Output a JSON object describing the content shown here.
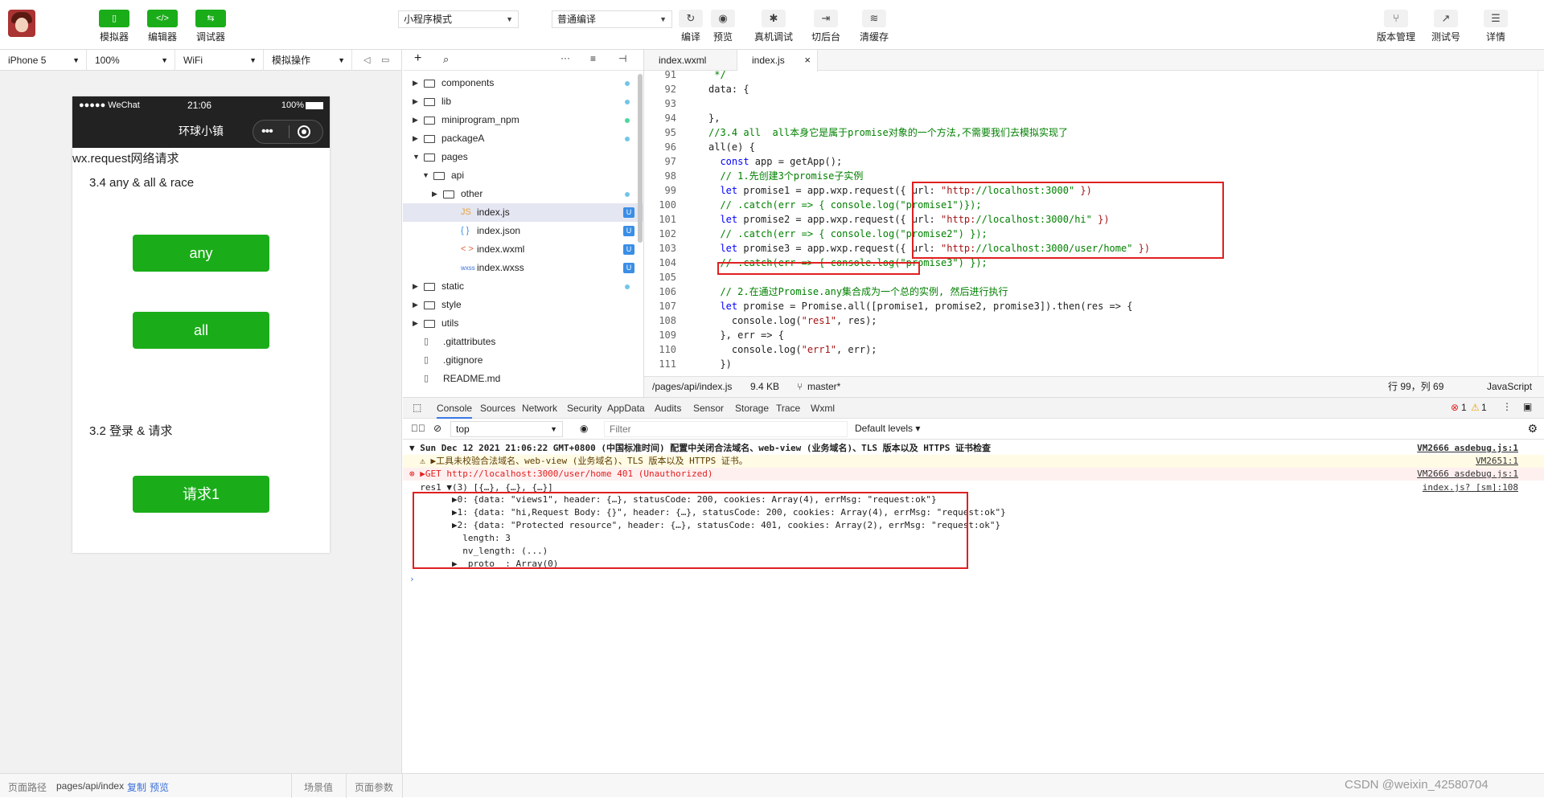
{
  "toolbar": {
    "left_buttons": [
      {
        "label": "模拟器",
        "icon": "phone-icon"
      },
      {
        "label": "编辑器",
        "icon": "code-icon"
      },
      {
        "label": "调试器",
        "icon": "debug-icon"
      }
    ],
    "mode_select": "小程序模式",
    "compile_select": "普通编译",
    "mid_buttons": [
      "编译",
      "预览",
      "真机调试",
      "切后台",
      "清缓存"
    ],
    "right_buttons": [
      "版本管理",
      "测试号",
      "详情"
    ]
  },
  "devbar": {
    "device": "iPhone 5",
    "zoom": "100%",
    "network": "WiFi",
    "operation": "模拟操作"
  },
  "phone": {
    "carrier": "●●●●● WeChat",
    "time": "21:06",
    "battery": "100%",
    "nav_title": "环球小镇",
    "heading": "wx.request网络请求",
    "section1": "3.4 any & all & race",
    "btn_any": "any",
    "btn_all": "all",
    "section2": "3.2 登录 & 请求",
    "btn_request": "请求1"
  },
  "filetree": {
    "items": [
      {
        "name": "components",
        "type": "folder",
        "level": 0,
        "open": false,
        "mark": "dot"
      },
      {
        "name": "lib",
        "type": "folder",
        "level": 0,
        "open": false,
        "mark": "dot"
      },
      {
        "name": "miniprogram_npm",
        "type": "folder",
        "level": 0,
        "open": false,
        "mark": "dot-green"
      },
      {
        "name": "packageA",
        "type": "folder",
        "level": 0,
        "open": false,
        "mark": "dot"
      },
      {
        "name": "pages",
        "type": "folder",
        "level": 0,
        "open": true,
        "mark": ""
      },
      {
        "name": "api",
        "type": "folder",
        "level": 1,
        "open": true,
        "mark": ""
      },
      {
        "name": "other",
        "type": "folder",
        "level": 2,
        "open": false,
        "mark": "dot"
      },
      {
        "name": "index.js",
        "type": "js",
        "level": 2,
        "open": false,
        "mark": "U",
        "selected": true
      },
      {
        "name": "index.json",
        "type": "json",
        "level": 2,
        "open": false,
        "mark": "U"
      },
      {
        "name": "index.wxml",
        "type": "wxml",
        "level": 2,
        "open": false,
        "mark": "U"
      },
      {
        "name": "index.wxss",
        "type": "wxss",
        "level": 2,
        "open": false,
        "mark": "U"
      },
      {
        "name": "static",
        "type": "folder",
        "level": 0,
        "open": false,
        "mark": "dot"
      },
      {
        "name": "style",
        "type": "folder",
        "level": 0,
        "open": false,
        "mark": ""
      },
      {
        "name": "utils",
        "type": "folder",
        "level": 0,
        "open": false,
        "mark": ""
      },
      {
        "name": ".gitattributes",
        "type": "file",
        "level": 0,
        "open": false,
        "mark": ""
      },
      {
        "name": ".gitignore",
        "type": "file",
        "level": 0,
        "open": false,
        "mark": ""
      },
      {
        "name": "README.md",
        "type": "file",
        "level": 0,
        "open": false,
        "mark": ""
      }
    ]
  },
  "editor": {
    "tabs": [
      "index.wxml",
      "index.js"
    ],
    "lines": [
      {
        "n": "91",
        "t": " */",
        "c": "com"
      },
      {
        "n": "92",
        "t": "data: {",
        "c": ""
      },
      {
        "n": "93",
        "t": "",
        "c": ""
      },
      {
        "n": "94",
        "t": "},",
        "c": ""
      },
      {
        "n": "95",
        "t": "//3.4 all  all本身它是属于promise对象的一个方法,不需要我们去模拟实现了",
        "c": "com"
      },
      {
        "n": "96",
        "t": "all(e) {",
        "c": ""
      },
      {
        "n": "97",
        "t": "  const app = getApp();",
        "c": ""
      },
      {
        "n": "98",
        "t": "  // 1.先创建3个promise子实例",
        "c": "com"
      },
      {
        "n": "99",
        "t": "  let promise1 = app.wxp.request({ url: \"http://localhost:3000\" })",
        "c": ""
      },
      {
        "n": "100",
        "t": "  // .catch(err => { console.log(\"promise1\")});",
        "c": "com"
      },
      {
        "n": "101",
        "t": "  let promise2 = app.wxp.request({ url: \"http://localhost:3000/hi\" })",
        "c": ""
      },
      {
        "n": "102",
        "t": "  // .catch(err => { console.log(\"promise2\") });",
        "c": "com"
      },
      {
        "n": "103",
        "t": "  let promise3 = app.wxp.request({ url: \"http://localhost:3000/user/home\" })",
        "c": ""
      },
      {
        "n": "104",
        "t": "  // .catch(err => { console.log(\"promise3\") });",
        "c": "com"
      },
      {
        "n": "105",
        "t": "",
        "c": ""
      },
      {
        "n": "106",
        "t": "  // 2.在通过Promise.any集合成为一个总的实例, 然后进行执行",
        "c": "com"
      },
      {
        "n": "107",
        "t": "  let promise = Promise.all([promise1, promise2, promise3]).then(res => {",
        "c": ""
      },
      {
        "n": "108",
        "t": "    console.log(\"res1\", res);",
        "c": ""
      },
      {
        "n": "109",
        "t": "  }, err => {",
        "c": ""
      },
      {
        "n": "110",
        "t": "    console.log(\"err1\", err);",
        "c": ""
      },
      {
        "n": "111",
        "t": "  })",
        "c": ""
      }
    ],
    "status_path": "/pages/api/index.js",
    "status_size": "9.4 KB",
    "status_branch": "master*",
    "status_pos": "行 99，列 69",
    "status_lang": "JavaScript"
  },
  "console": {
    "tabs": [
      "Console",
      "Sources",
      "Network",
      "Security",
      "AppData",
      "Audits",
      "Sensor",
      "Storage",
      "Trace",
      "Wxml"
    ],
    "errors": "1",
    "warnings": "1",
    "context": "top",
    "filter_placeholder": "Filter",
    "levels": "Default levels ▾",
    "lines": [
      {
        "text": "▼ Sun Dec 12 2021 21:06:22 GMT+0800 (中国标准时间) 配置中关闭合法域名、web-view (业务域名)、TLS 版本以及 HTTPS 证书检查",
        "src": "VM2666 asdebug.js:1",
        "kind": "info"
      },
      {
        "text": "  ⚠ ▶工具未校验合法域名、web-view (业务域名)、TLS 版本以及 HTTPS 证书。",
        "src": "VM2651:1",
        "kind": "warn"
      },
      {
        "text": "⊗ ▶GET http://localhost:3000/user/home 401 (Unauthorized)",
        "src": "VM2666 asdebug.js:1",
        "kind": "error"
      },
      {
        "text": "  res1 ▼(3) [{…}, {…}, {…}]",
        "src": "index.js? [sm]:108",
        "kind": "log"
      },
      {
        "text": "        ▶0: {data: \"views1\", header: {…}, statusCode: 200, cookies: Array(4), errMsg: \"request:ok\"}",
        "src": "",
        "kind": "log"
      },
      {
        "text": "        ▶1: {data: \"hi,Request Body: {}\", header: {…}, statusCode: 200, cookies: Array(4), errMsg: \"request:ok\"}",
        "src": "",
        "kind": "log"
      },
      {
        "text": "        ▶2: {data: \"Protected resource\", header: {…}, statusCode: 401, cookies: Array(2), errMsg: \"request:ok\"}",
        "src": "",
        "kind": "log"
      },
      {
        "text": "          length: 3",
        "src": "",
        "kind": "log"
      },
      {
        "text": "          nv_length: (...)",
        "src": "",
        "kind": "log"
      },
      {
        "text": "        ▶__proto__: Array(0)",
        "src": "",
        "kind": "log"
      }
    ]
  },
  "bottom": {
    "path_label": "页面路径",
    "path": "pages/api/index",
    "copy": "复制",
    "preview": "预览",
    "scene": "场景值",
    "params": "页面参数",
    "watermark": "CSDN @weixin_42580704"
  }
}
